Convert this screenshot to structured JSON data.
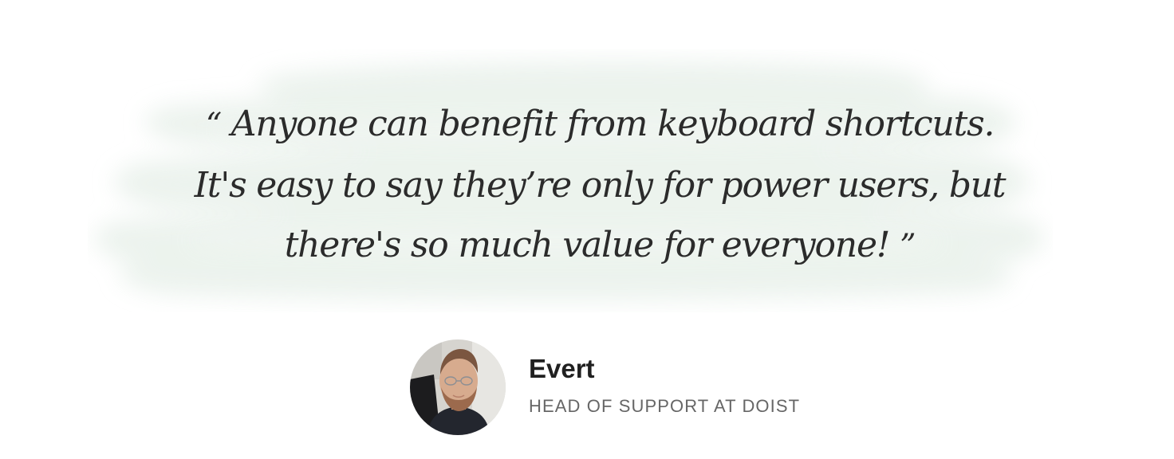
{
  "testimonial": {
    "open_mark": "“",
    "quote_text": "Anyone can benefit from keyboard shortcuts. It's easy to say they’re only for power users, but there's so much value for everyone!",
    "close_mark": "”",
    "author_name": "Evert",
    "author_role": "HEAD OF SUPPORT AT DOIST",
    "avatar_icon": "person-photo"
  },
  "colors": {
    "background": "#ffffff",
    "brush_highlight": "#eef4ef",
    "quote_text": "#2b2b2b",
    "name_text": "#202020",
    "role_text": "#666666"
  }
}
